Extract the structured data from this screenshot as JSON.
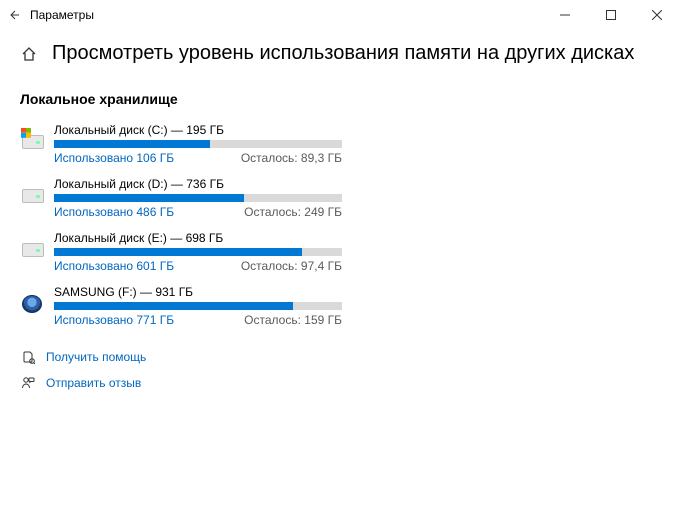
{
  "window": {
    "app_name": "Параметры"
  },
  "header": {
    "page_title": "Просмотреть уровень использования памяти на других дисках"
  },
  "storage": {
    "section_title": "Локальное хранилище",
    "disks": [
      {
        "icon": "system-drive",
        "title": "Локальный диск (C:) — 195 ГБ",
        "used_label": "Использовано 106 ГБ",
        "remaining_label": "Осталось: 89,3 ГБ",
        "fill_percent": 54
      },
      {
        "icon": "hdd-drive",
        "title": "Локальный диск (D:) — 736 ГБ",
        "used_label": "Использовано 486 ГБ",
        "remaining_label": "Осталось: 249 ГБ",
        "fill_percent": 66
      },
      {
        "icon": "hdd-drive",
        "title": "Локальный диск (E:) — 698 ГБ",
        "used_label": "Использовано 601 ГБ",
        "remaining_label": "Осталось: 97,4 ГБ",
        "fill_percent": 86
      },
      {
        "icon": "external-drive",
        "title": "SAMSUNG (F:) — 931 ГБ",
        "used_label": "Использовано 771 ГБ",
        "remaining_label": "Осталось: 159 ГБ",
        "fill_percent": 83
      }
    ]
  },
  "links": {
    "help": "Получить помощь",
    "feedback": "Отправить отзыв"
  }
}
